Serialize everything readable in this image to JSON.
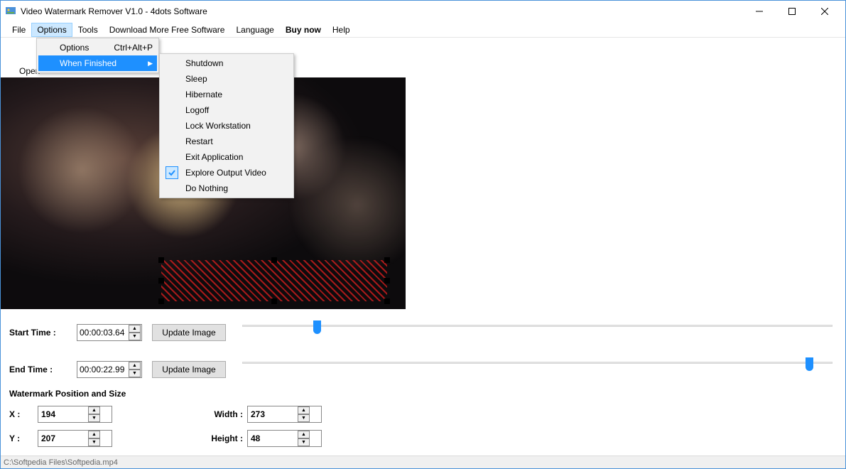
{
  "title": "Video Watermark Remover V1.0 - 4dots Software",
  "menubar": {
    "file": "File",
    "options": "Options",
    "tools": "Tools",
    "download": "Download More Free Software",
    "language": "Language",
    "buy": "Buy now",
    "help": "Help"
  },
  "dropdown": {
    "options_label": "Options",
    "options_shortcut": "Ctrl+Alt+P",
    "when_finished": "When Finished"
  },
  "submenu": {
    "shutdown": "Shutdown",
    "sleep": "Sleep",
    "hibernate": "Hibernate",
    "logoff": "Logoff",
    "lock": "Lock Workstation",
    "restart": "Restart",
    "exit": "Exit Application",
    "explore": "Explore Output Video",
    "nothing": "Do Nothing"
  },
  "toolbar": {
    "open": "Open"
  },
  "timing": {
    "start_label": "Start Time :",
    "start_value": "00:00:03.64",
    "end_label": "End Time :",
    "end_value": "00:00:22.99",
    "update_btn": "Update Image"
  },
  "wm": {
    "group_title": "Watermark Position and Size",
    "x_label": "X :",
    "y_label": "Y :",
    "w_label": "Width :",
    "h_label": "Height :",
    "x": "194",
    "y": "207",
    "w": "273",
    "h": "48"
  },
  "status": "C:\\Softpedia Files\\Softpedia.mp4"
}
